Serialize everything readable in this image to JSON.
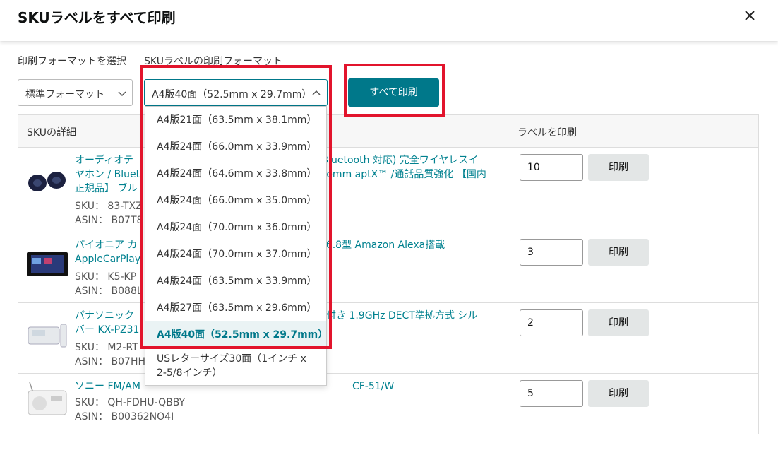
{
  "modal": {
    "title": "SKUラベルをすべて印刷",
    "close_icon": "close-icon"
  },
  "format_select": {
    "label": "印刷フォーマットを選択",
    "value": "標準フォーマット"
  },
  "sku_format_select": {
    "label": "SKUラベルの印刷フォーマット",
    "value": "A4版40面（52.5mm x 29.7mm）",
    "options": [
      "A4版21面（63.5mm x 38.1mm）",
      "A4版24面（66.0mm x 33.9mm）",
      "A4版24面（64.6mm x 33.8mm）",
      "A4版24面（66.0mm x 35.0mm）",
      "A4版24面（70.0mm x 36.0mm）",
      "A4版24面（70.0mm x 37.0mm）",
      "A4版24面（63.5mm x 33.9mm）",
      "A4版27面（63.5mm x 29.6mm）",
      "A4版40面（52.5mm x 29.7mm）",
      "USレターサイズ30面（1インチ x 2-5/8インチ）"
    ],
    "selected_index": 8
  },
  "print_all_button": "すべて印刷",
  "table": {
    "col_sku": "SKUの詳細",
    "col_print": "ラベルを印刷",
    "print_label": "印刷",
    "sku_label": "SKU：",
    "asin_label": "ASIN：",
    "rows": [
      {
        "title_left": "オーディオテ",
        "title_right": "ン Bluetooth 対応) 完全ワイヤレスイ",
        "title2_left": "ヤホン / Bluet",
        "title2_right": "acomm aptX™ /通話品質強化 【国内",
        "title3": "正規品】 ブル",
        "sku": "83-TXZ",
        "asin": "B07T8",
        "qty": "10"
      },
      {
        "title_left": "パイオニア カ",
        "title_right": "0 6.8型 Amazon Alexa搭載",
        "title2_left": "AppleCarPlay",
        "sku": "K5-KP",
        "asin": "B088L",
        "qty": "3"
      },
      {
        "title_left": "パナソニック",
        "title_right": "台付き 1.9GHz DECT準拠方式 シル",
        "title2_left": "バー KX-PZ31",
        "sku": "M2-RT",
        "asin": "B07HH",
        "qty": "2"
      },
      {
        "title_left": "ソニー FM/AM",
        "title_right": "CF-51/W",
        "sku": "QH-FDHU-QBBY",
        "asin": "B00362NO4I",
        "qty": "5"
      }
    ]
  },
  "colors": {
    "accent": "#00788a",
    "highlight_border": "#e2142c",
    "link": "#00818f"
  }
}
